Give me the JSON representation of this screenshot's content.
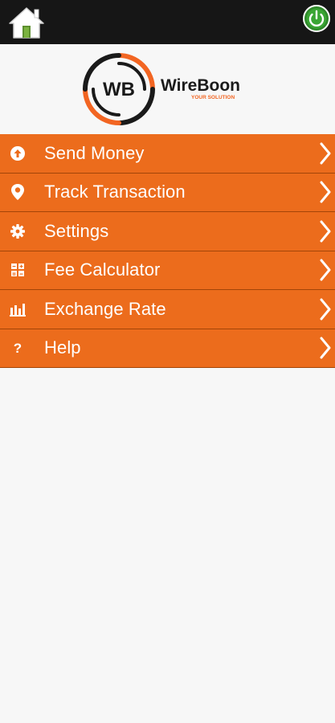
{
  "header": {
    "home_icon": "home-icon",
    "power_icon": "power-icon"
  },
  "logo": {
    "initials": "WB",
    "brand": "WireBoon",
    "tagline": "YOUR SOLUTION"
  },
  "menu": {
    "items": [
      {
        "label": "Send Money",
        "icon": "upload-circle-icon"
      },
      {
        "label": "Track Transaction",
        "icon": "location-pin-icon"
      },
      {
        "label": "Settings",
        "icon": "gear-icon"
      },
      {
        "label": "Fee Calculator",
        "icon": "calculator-icon"
      },
      {
        "label": "Exchange Rate",
        "icon": "bar-chart-icon"
      },
      {
        "label": "Help",
        "icon": "question-icon"
      }
    ]
  },
  "colors": {
    "menu_bg": "#ec6c1c",
    "topbar_bg": "#161616",
    "brand_accent": "#f26522"
  }
}
